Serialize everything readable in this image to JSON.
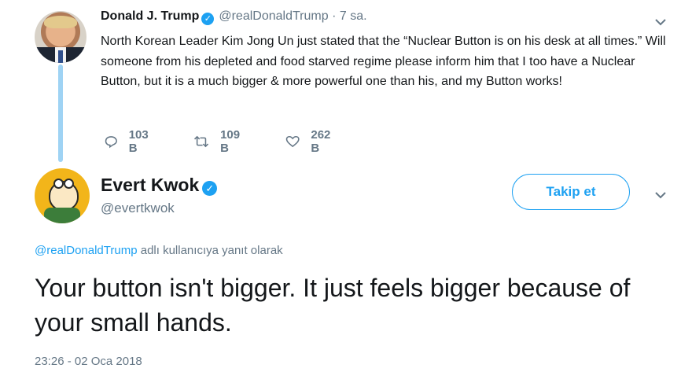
{
  "parent_tweet": {
    "author_name": "Donald J. Trump",
    "verified_mark": "✓",
    "handle": "@realDonaldTrump",
    "separator": "·",
    "time": "7 sa.",
    "text": "North Korean Leader Kim Jong Un just stated that the “Nuclear Button is on his desk at all times.” Will someone from his depleted and food starved regime please inform him that I too have a Nuclear Button, but it is a much bigger & more powerful one than his, and my Button works!",
    "reply_count": "103 B",
    "retweet_count": "109 B",
    "like_count": "262 B",
    "menu_icon": "chevron-down-icon"
  },
  "reply_tweet": {
    "author_name": "Evert Kwok",
    "verified_mark": "✓",
    "handle": "@evertkwok",
    "follow_label": "Takip et",
    "reply_to_mention": "@realDonaldTrump",
    "reply_to_suffix": " adlı kullanıcıya yanıt olarak",
    "text": "Your button isn't bigger. It just feels bigger because of your small hands.",
    "timestamp": "23:26 - 02 Oca 2018",
    "menu_icon": "chevron-down-icon"
  },
  "colors": {
    "accent": "#1da1f2",
    "secondary_text": "#657786",
    "primary_text": "#14171a",
    "thread_line": "#9fd3f4"
  }
}
